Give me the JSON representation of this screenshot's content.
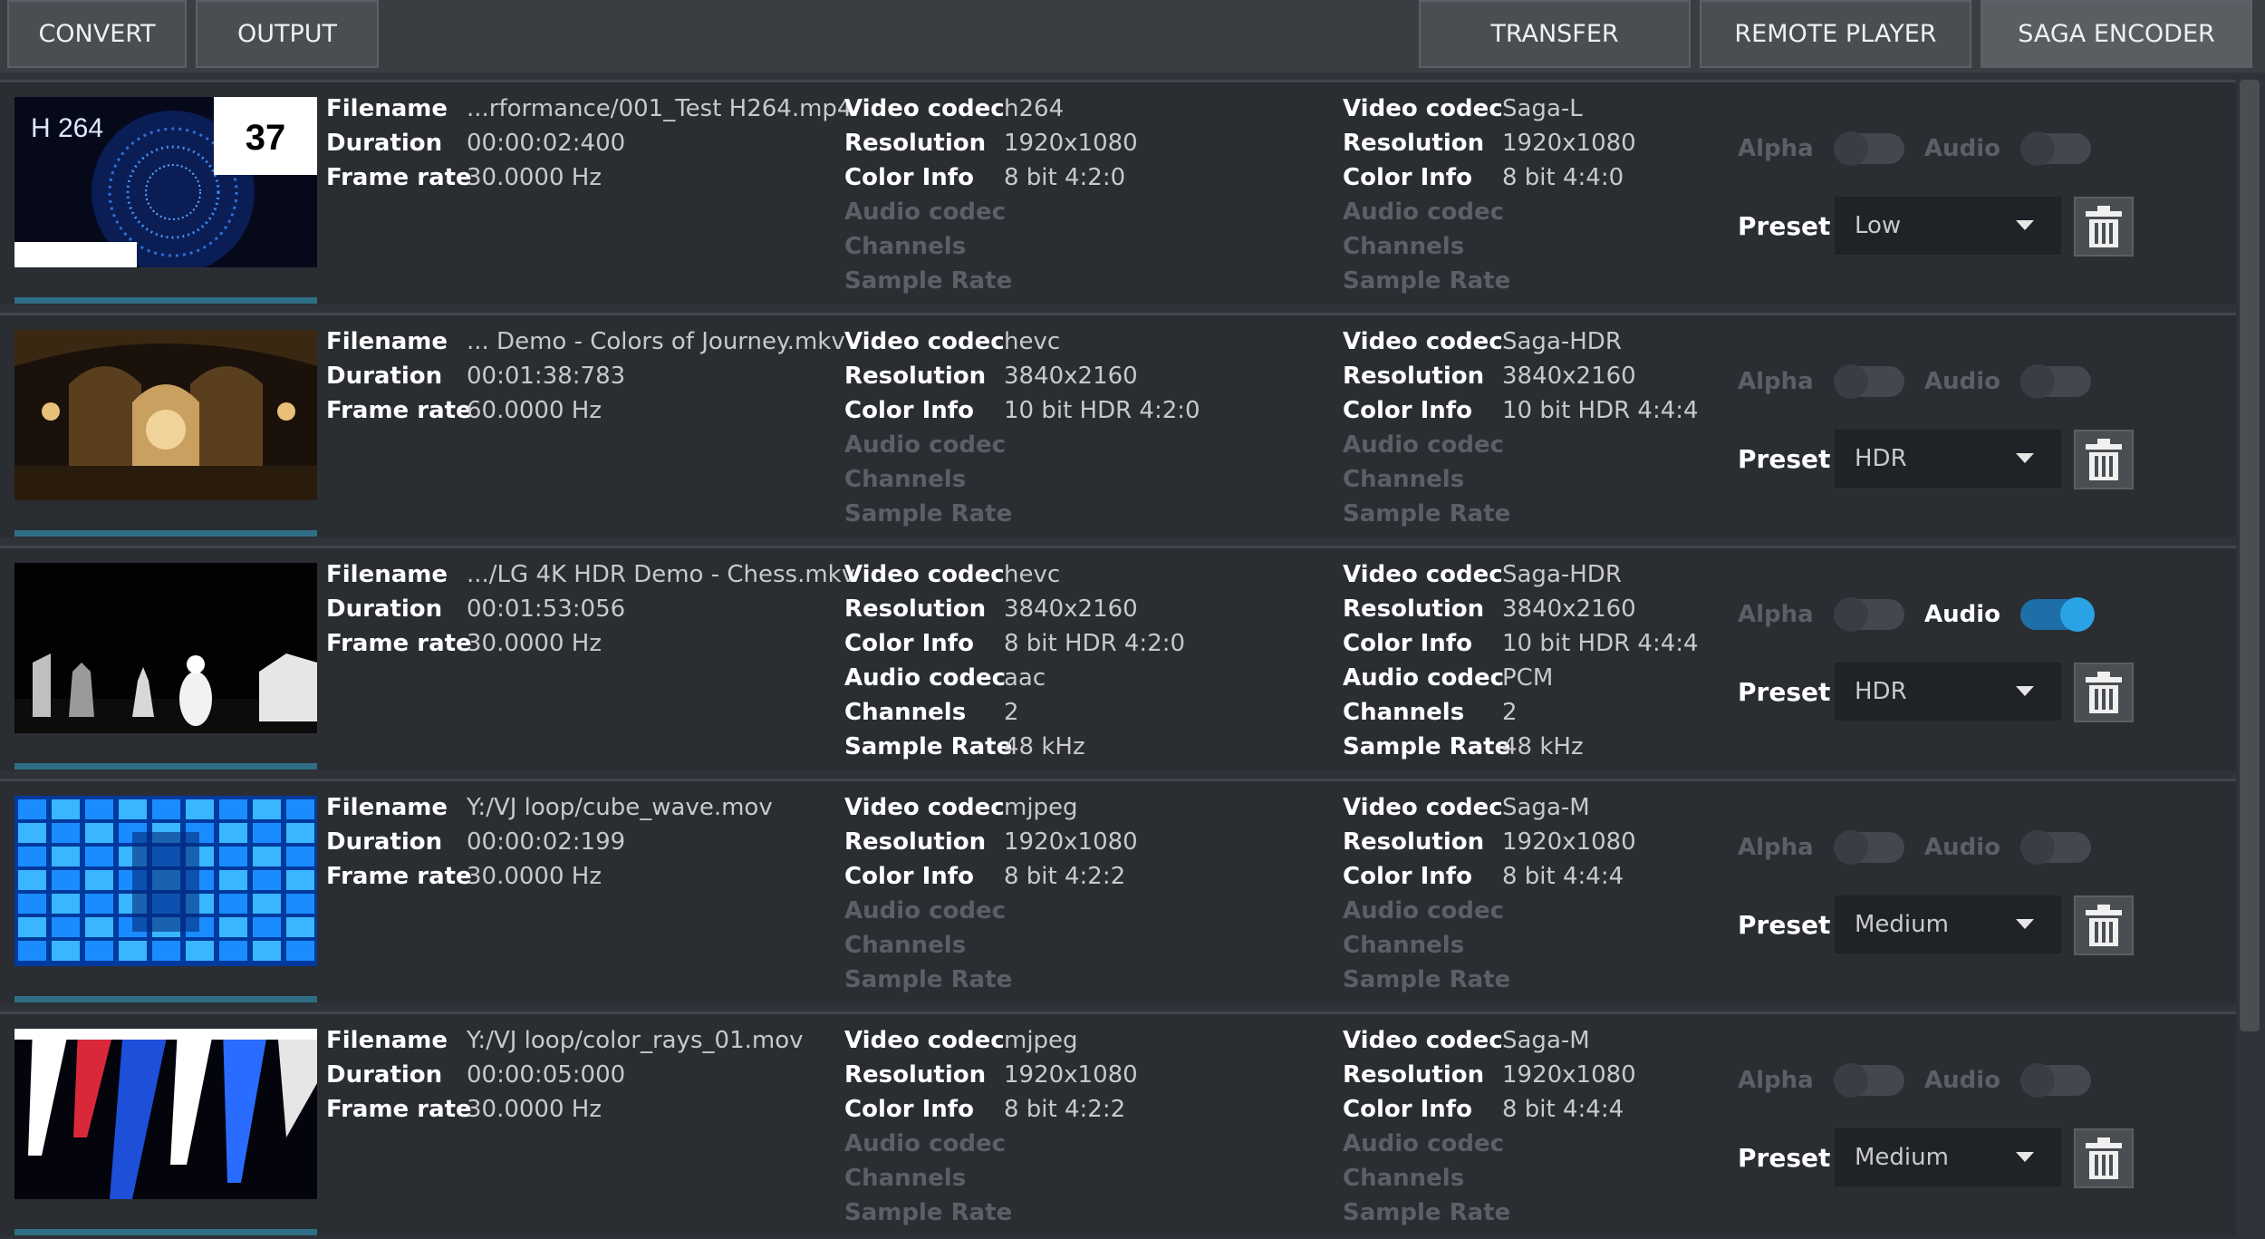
{
  "toolbar": {
    "left": [
      {
        "label": "CONVERT"
      },
      {
        "label": "OUTPUT"
      }
    ],
    "right": [
      {
        "label": "TRANSFER"
      },
      {
        "label": "REMOTE PLAYER"
      },
      {
        "label": "SAGA ENCODER"
      }
    ]
  },
  "labels": {
    "filename": "Filename",
    "duration": "Duration",
    "frame_rate": "Frame rate",
    "video_codec": "Video codec",
    "resolution": "Resolution",
    "color_info": "Color Info",
    "audio_codec": "Audio codec",
    "channels": "Channels",
    "sample_rate": "Sample Rate",
    "alpha": "Alpha",
    "audio": "Audio",
    "preset": "Preset"
  },
  "rows": [
    {
      "thumb_text": "H 264",
      "thumb_badge": "37",
      "filename": "...rformance/001_Test H264.mp4",
      "duration": "00:00:02:400",
      "frame_rate": "30.0000 Hz",
      "src_video_codec": "h264",
      "src_resolution": "1920x1080",
      "src_color_info": "8 bit 4:2:0",
      "src_audio_codec": "",
      "src_channels": "",
      "src_sample_rate": "",
      "dst_video_codec": "Saga-L",
      "dst_resolution": "1920x1080",
      "dst_color_info": "8 bit 4:4:0",
      "dst_audio_codec": "",
      "dst_channels": "",
      "dst_sample_rate": "",
      "alpha_on": false,
      "audio_on": false,
      "has_audio": false,
      "preset": "Low"
    },
    {
      "thumb_text": "",
      "thumb_badge": "",
      "filename": "... Demo - Colors of Journey.mkv",
      "duration": "00:01:38:783",
      "frame_rate": "60.0000 Hz",
      "src_video_codec": "hevc",
      "src_resolution": "3840x2160",
      "src_color_info": "10 bit HDR 4:2:0",
      "src_audio_codec": "",
      "src_channels": "",
      "src_sample_rate": "",
      "dst_video_codec": "Saga-HDR",
      "dst_resolution": "3840x2160",
      "dst_color_info": "10 bit HDR 4:4:4",
      "dst_audio_codec": "",
      "dst_channels": "",
      "dst_sample_rate": "",
      "alpha_on": false,
      "audio_on": false,
      "has_audio": false,
      "preset": "HDR"
    },
    {
      "thumb_text": "",
      "thumb_badge": "",
      "filename": ".../LG 4K HDR Demo - Chess.mkv",
      "duration": "00:01:53:056",
      "frame_rate": "30.0000 Hz",
      "src_video_codec": "hevc",
      "src_resolution": "3840x2160",
      "src_color_info": "8 bit HDR 4:2:0",
      "src_audio_codec": "aac",
      "src_channels": "2",
      "src_sample_rate": "48 kHz",
      "dst_video_codec": "Saga-HDR",
      "dst_resolution": "3840x2160",
      "dst_color_info": "10 bit HDR 4:4:4",
      "dst_audio_codec": "PCM",
      "dst_channels": "2",
      "dst_sample_rate": "48 kHz",
      "alpha_on": false,
      "audio_on": true,
      "has_audio": true,
      "preset": "HDR"
    },
    {
      "thumb_text": "",
      "thumb_badge": "",
      "filename": "Y:/VJ loop/cube_wave.mov",
      "duration": "00:00:02:199",
      "frame_rate": "30.0000 Hz",
      "src_video_codec": "mjpeg",
      "src_resolution": "1920x1080",
      "src_color_info": "8 bit 4:2:2",
      "src_audio_codec": "",
      "src_channels": "",
      "src_sample_rate": "",
      "dst_video_codec": "Saga-M",
      "dst_resolution": "1920x1080",
      "dst_color_info": "8 bit 4:4:4",
      "dst_audio_codec": "",
      "dst_channels": "",
      "dst_sample_rate": "",
      "alpha_on": false,
      "audio_on": false,
      "has_audio": false,
      "preset": "Medium"
    },
    {
      "thumb_text": "",
      "thumb_badge": "",
      "filename": "Y:/VJ loop/color_rays_01.mov",
      "duration": "00:00:05:000",
      "frame_rate": "30.0000 Hz",
      "src_video_codec": "mjpeg",
      "src_resolution": "1920x1080",
      "src_color_info": "8 bit 4:2:2",
      "src_audio_codec": "",
      "src_channels": "",
      "src_sample_rate": "",
      "dst_video_codec": "Saga-M",
      "dst_resolution": "1920x1080",
      "dst_color_info": "8 bit 4:4:4",
      "dst_audio_codec": "",
      "dst_channels": "",
      "dst_sample_rate": "",
      "alpha_on": false,
      "audio_on": false,
      "has_audio": false,
      "preset": "Medium"
    }
  ]
}
